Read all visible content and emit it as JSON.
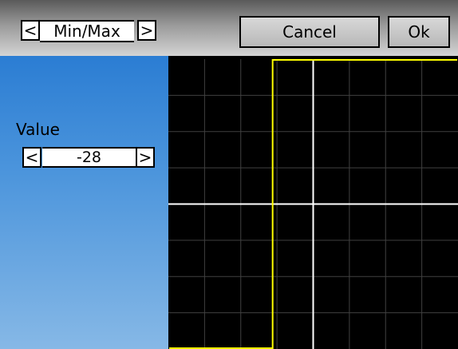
{
  "header": {
    "mode_label": "Min/Max",
    "prev_arrow": "<",
    "next_arrow": ">",
    "cancel_label": "Cancel",
    "ok_label": "Ok"
  },
  "value_panel": {
    "label": "Value",
    "value": "-28",
    "prev_arrow": "<",
    "next_arrow": ">"
  },
  "chart_data": {
    "type": "line",
    "x": [
      -100,
      -28,
      -28,
      100
    ],
    "y": [
      -100,
      -100,
      100,
      100
    ],
    "xlim": [
      -100,
      100
    ],
    "ylim": [
      -100,
      100
    ],
    "grid": true,
    "series_color": "#ffff00",
    "axis_color": "#ffffff",
    "grid_color": "#404040"
  }
}
